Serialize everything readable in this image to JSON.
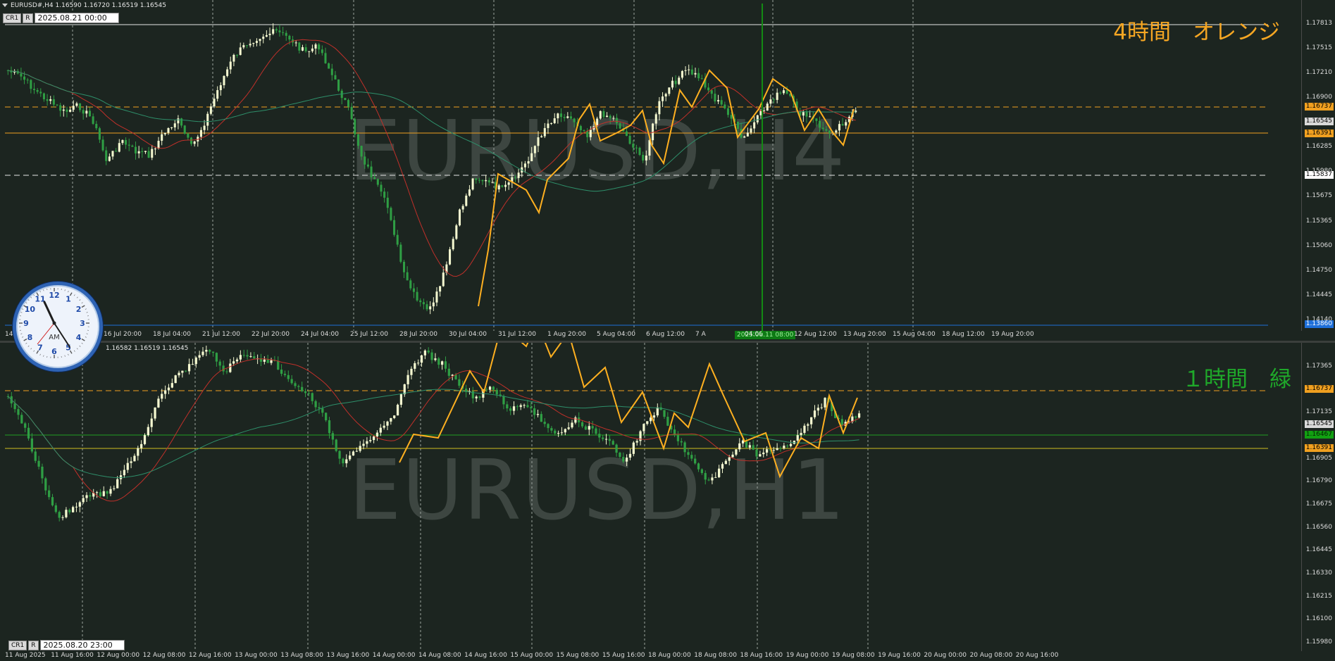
{
  "top_pane": {
    "symbol_info": "EURUSD#,H4  1.16590 1.16720 1.16519 1.16545",
    "chip_cr": "CR1",
    "chip_r": "R",
    "date_box": "2025.08.21 00:00",
    "tf_note": "4時間　オレンジ",
    "watermark": "EURUSD,H4",
    "y_labels": [
      "1.17813",
      "1.17515",
      "1.17210",
      "1.16900",
      "1.16595",
      "1.16285",
      "1.15980",
      "1.15675",
      "1.15365",
      "1.15060",
      "1.14750",
      "1.14445",
      "1.14140"
    ],
    "price_tags": [
      {
        "text": "1.16737",
        "bg": "#f0a020",
        "fg": "#000000"
      },
      {
        "text": "1.16545",
        "bg": "#d9d9d9",
        "fg": "#000000"
      },
      {
        "text": "1.16391",
        "bg": "#f0a020",
        "fg": "#000000"
      },
      {
        "text": "1.15837",
        "bg": "#ffffff",
        "fg": "#000000"
      },
      {
        "text": "1.13860",
        "bg": "#1e6fd9",
        "fg": "#ffffff"
      }
    ],
    "x_labels": [
      "14 Jul 04:00",
      "15 Jul 12:00",
      "16 Jul 20:00",
      "18 Jul 04:00",
      "21 Jul 12:00",
      "22 Jul 20:00",
      "24 Jul 04:00",
      "25 Jul 12:00",
      "28 Jul 20:00",
      "30 Jul 04:00",
      "31 Jul 12:00",
      "1 Aug 20:00",
      "5 Aug 04:00",
      "6 Aug 12:00",
      "7 A",
      "04:00",
      "12 Aug 12:00",
      "13 Aug 20:00",
      "15 Aug 04:00",
      "18 Aug 12:00",
      "19 Aug 20:00"
    ],
    "crosshair_tag": "2025.08.11 08:00"
  },
  "bottom_pane": {
    "symbol_info": "1.16582 1.16519 1.16545",
    "chip_cr": "CR1",
    "chip_r": "R",
    "date_box": "2025.08.20 23:00",
    "tf_note": "１時間　緑",
    "watermark": "EURUSD,H1",
    "y_labels": [
      "1.17365",
      "1.17250",
      "1.17135",
      "1.17020",
      "1.16905",
      "1.16790",
      "1.16675",
      "1.16560",
      "1.16445",
      "1.16330",
      "1.16215",
      "1.16100",
      "1.15980"
    ],
    "price_tags": [
      {
        "text": "1.16737",
        "bg": "#f0a020",
        "fg": "#000000"
      },
      {
        "text": "1.16545",
        "bg": "#d9d9d9",
        "fg": "#000000"
      },
      {
        "text": "1.16467",
        "bg": "#12a012",
        "fg": "#002200"
      },
      {
        "text": "1.16391",
        "bg": "#f0a020",
        "fg": "#000000"
      }
    ],
    "x_labels": [
      "11 Aug 2025",
      "11 Aug 16:00",
      "12 Aug 00:00",
      "12 Aug 08:00",
      "12 Aug 16:00",
      "13 Aug 00:00",
      "13 Aug 08:00",
      "13 Aug 16:00",
      "14 Aug 00:00",
      "14 Aug 08:00",
      "14 Aug 16:00",
      "15 Aug 00:00",
      "15 Aug 08:00",
      "15 Aug 16:00",
      "18 Aug 00:00",
      "18 Aug 08:00",
      "18 Aug 16:00",
      "19 Aug 00:00",
      "19 Aug 08:00",
      "19 Aug 16:00",
      "20 Aug 00:00",
      "20 Aug 08:00",
      "20 Aug 16:00"
    ]
  },
  "clock": {
    "am_label": "AM",
    "numbers": [
      "12",
      "1",
      "2",
      "3",
      "4",
      "5",
      "6",
      "7",
      "8",
      "9",
      "10",
      "11"
    ]
  },
  "colors": {
    "background": "#1c2520",
    "bull_candle": "#f4f8d0",
    "bear_candle": "#2f9e44",
    "zigzag": "#ffb020",
    "ma_fast": "#c0302a",
    "ma_slow": "#2e8f6a",
    "note_h4": "#f5a623",
    "note_h1": "#1fa82a"
  }
}
